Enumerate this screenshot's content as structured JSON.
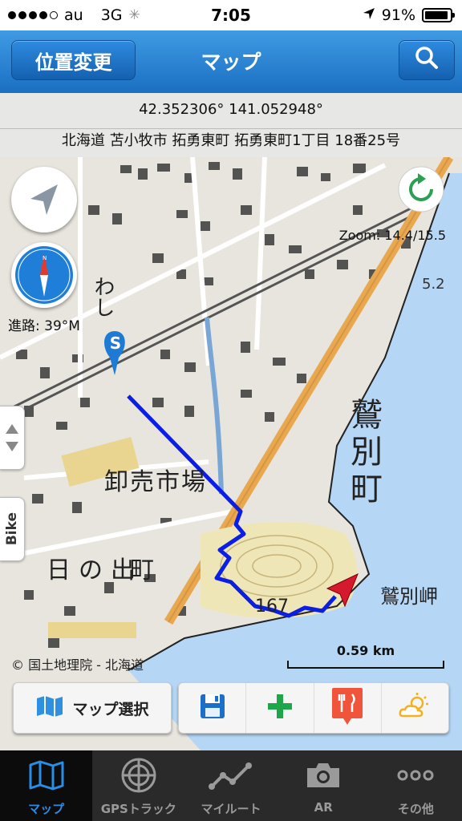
{
  "status_bar": {
    "carrier": "au",
    "network": "3G",
    "time": "7:05",
    "battery": "91%",
    "signal_bars_filled": 4,
    "signal_bars_total": 5
  },
  "nav_bar": {
    "left_button": "位置変更",
    "title": "マップ",
    "right_icon": "search-icon"
  },
  "location": {
    "coordinates": "42.352306° 141.052948°",
    "address": "北海道 苫小牧市 拓勇東町 拓勇東町1丁目 18番25号"
  },
  "map": {
    "zoom": "Zoom: 14.4/15.5",
    "heading": "進路: 39°M",
    "start_marker": "S",
    "credit": "© 国土地理院 - 北海道",
    "scale": "0.59 km",
    "side_tab_label": "Bike",
    "labels": {
      "washi": "わし",
      "market": "卸売市場",
      "hinode": "日の出",
      "machi": "町",
      "sagibetsu_vertical": "鷲別町",
      "cape": "鷲別岬",
      "height": "5.2",
      "elev": "167"
    }
  },
  "toolbar": {
    "map_select": "マップ選択",
    "icons": [
      "save-icon",
      "plus-icon",
      "restaurant-icon",
      "weather-icon"
    ]
  },
  "tab_bar": {
    "tabs": [
      {
        "label": "マップ",
        "icon": "map-icon",
        "active": true
      },
      {
        "label": "GPSトラック",
        "icon": "radar-icon",
        "active": false
      },
      {
        "label": "マイルート",
        "icon": "route-icon",
        "active": false
      },
      {
        "label": "AR",
        "icon": "camera-icon",
        "active": false
      },
      {
        "label": "その他",
        "icon": "more-icon",
        "active": false
      }
    ]
  },
  "colors": {
    "nav_blue": "#1b6fc2",
    "track_blue": "#0a1ee6",
    "sea": "#b5d6f5",
    "tab_active": "#2a8de6",
    "restaurant": "#f0543a",
    "plus": "#1fa54a",
    "weather": "#f3b21d"
  }
}
